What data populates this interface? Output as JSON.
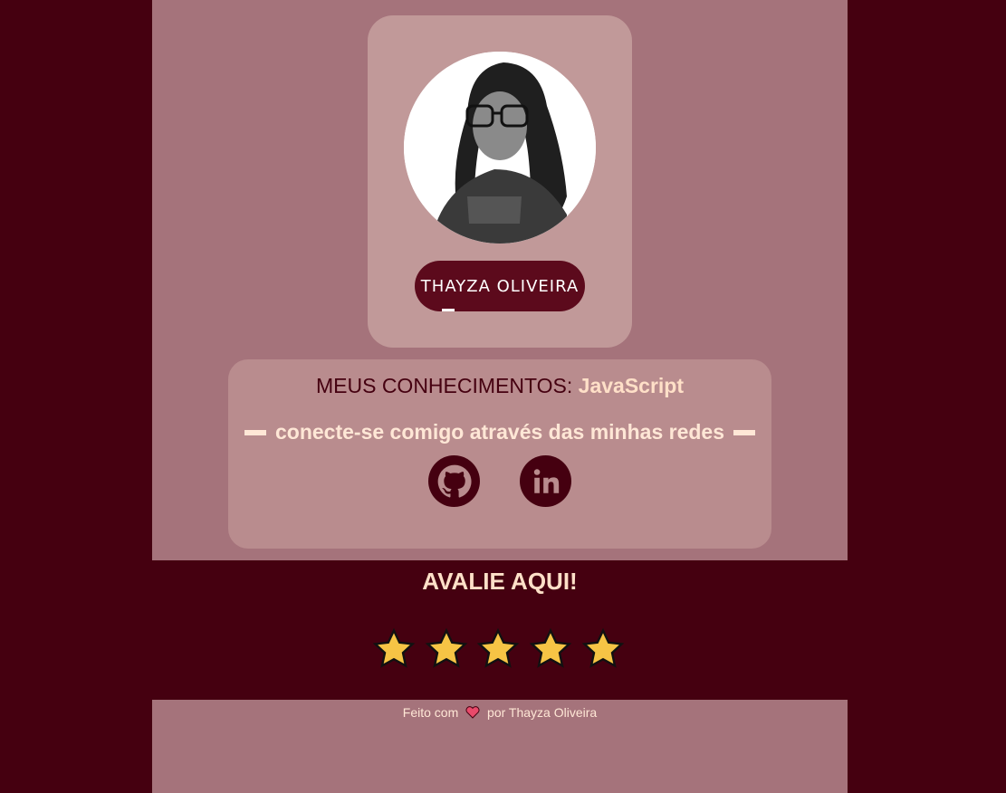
{
  "profile": {
    "name": "THAYZA OLIVEIRA",
    "avatar_icon": "profile-photo"
  },
  "skills": {
    "label": "MEUS CONHECIMENTOS:",
    "value": "JavaScript"
  },
  "connect": {
    "text": "conecte-se comigo através das minhas redes"
  },
  "social": {
    "items": [
      "github-icon",
      "linkedin-icon"
    ]
  },
  "rating": {
    "title": "AVALIE AQUI!",
    "stars": 5,
    "star_color": "#f6c445"
  },
  "footer": {
    "prefix": "Feito com",
    "suffix": "por Thayza Oliveira",
    "heart_icon": "heart-icon"
  },
  "colors": {
    "background": "#450010",
    "panel": "#a5737b",
    "card": "#c19999",
    "accent": "#5c0a1c",
    "highlight": "#ffe0c8"
  }
}
